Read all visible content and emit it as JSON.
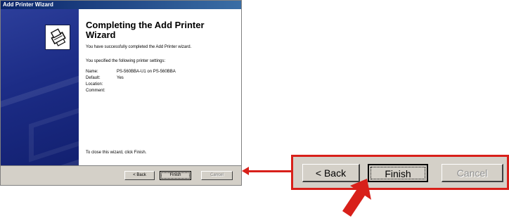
{
  "window": {
    "title": "Add Printer Wizard"
  },
  "wizard": {
    "heading": "Completing the Add Printer Wizard",
    "success_text": "You have successfully completed the Add Printer wizard.",
    "settings_intro": "You specified the following printer settings:",
    "settings": [
      {
        "label": "Name:",
        "value": "PS-560BBA-U1 on PS-560BBA"
      },
      {
        "label": "Default:",
        "value": "Yes"
      },
      {
        "label": "Location:",
        "value": ""
      },
      {
        "label": "Comment:",
        "value": ""
      }
    ],
    "close_text": "To close this wizard, click Finish."
  },
  "buttons": {
    "back": "< Back",
    "finish": "Finish",
    "cancel": "Cancel"
  },
  "zoom_buttons": {
    "back": "< Back",
    "finish": "Finish",
    "cancel": "Cancel"
  },
  "colors": {
    "titlebar": "#0a246a",
    "sidebar": "#1c2c86",
    "dialog_gray": "#d4d0c8",
    "highlight_red": "#d8201a"
  },
  "icons": {
    "sidebar_logo": "printer-icon",
    "pointer": "red-arrow-icon"
  }
}
